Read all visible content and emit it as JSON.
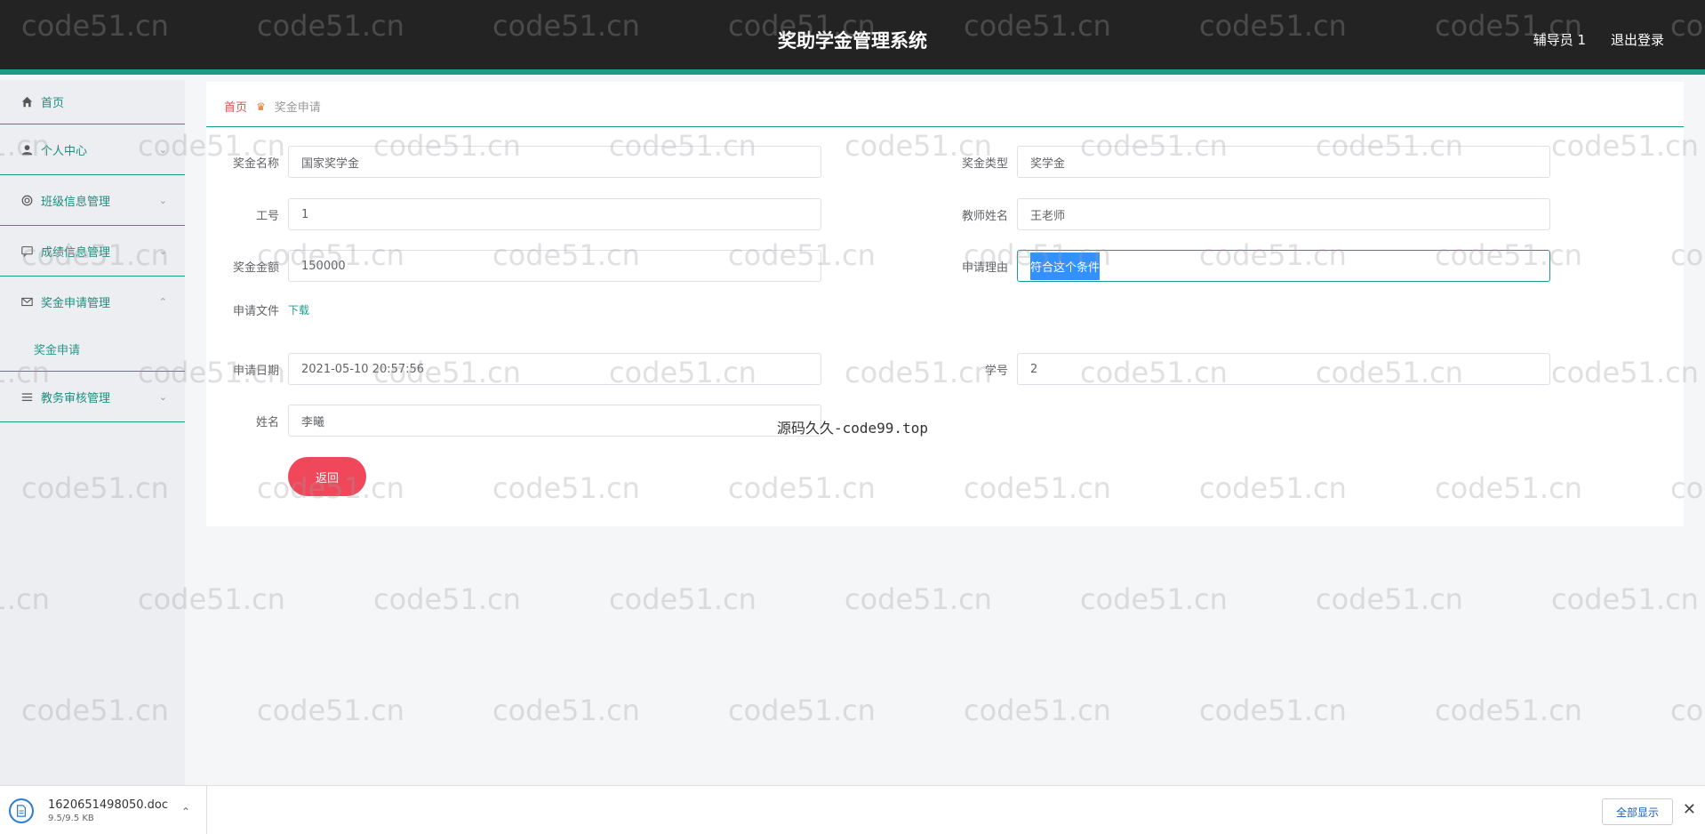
{
  "header": {
    "title": "奖助学金管理系统",
    "user": "辅导员 1",
    "logout": "退出登录"
  },
  "sidebar": {
    "items": [
      {
        "label": "首页",
        "icon": "home-icon"
      },
      {
        "label": "个人中心",
        "icon": "user-icon"
      },
      {
        "label": "班级信息管理",
        "icon": "circle-icon"
      },
      {
        "label": "成绩信息管理",
        "icon": "chat-icon"
      },
      {
        "label": "奖金申请管理",
        "icon": "mail-icon"
      },
      {
        "label": "奖金申请"
      },
      {
        "label": "教务审核管理",
        "icon": "list-icon"
      }
    ]
  },
  "breadcrumb": {
    "home": "首页",
    "current": "奖金申请"
  },
  "form": {
    "award_name_label": "奖金名称",
    "award_name": "国家奖学金",
    "award_type_label": "奖金类型",
    "award_type": "奖学金",
    "job_no_label": "工号",
    "job_no": "1",
    "teacher_label": "教师姓名",
    "teacher": "王老师",
    "amount_label": "奖金金额",
    "amount": "150000",
    "reason_label": "申请理由",
    "reason": "符合这个条件",
    "file_label": "申请文件",
    "file_link": "下载",
    "date_label": "申请日期",
    "date": "2021-05-10 20:57:56",
    "student_no_label": "学号",
    "student_no": "2",
    "name_label": "姓名",
    "name": "李曦",
    "back_button": "返回"
  },
  "overlay_text": "源码久久-code99.top",
  "watermark": "code51.cn",
  "download_bar": {
    "filename": "1620651498050.doc",
    "size": "9.5/9.5 KB",
    "show_all": "全部显示",
    "close": "✕"
  }
}
